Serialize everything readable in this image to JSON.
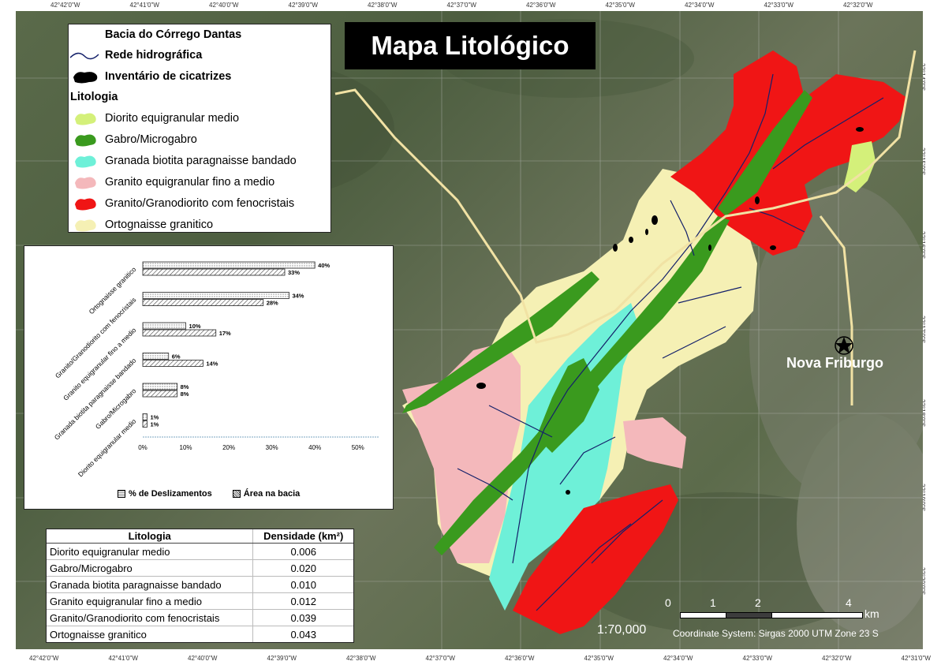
{
  "title": "Mapa Litológico",
  "coords_top": [
    "42°42'0\"W",
    "42°41'0\"W",
    "42°40'0\"W",
    "42°39'0\"W",
    "42°38'0\"W",
    "42°37'0\"W",
    "42°36'0\"W",
    "42°35'0\"W",
    "42°34'0\"W",
    "42°33'0\"W",
    "42°32'0\"W"
  ],
  "coords_bottom": [
    "42°42'0\"W",
    "42°41'0\"W",
    "42°40'0\"W",
    "42°39'0\"W",
    "42°38'0\"W",
    "42°37'0\"W",
    "42°36'0\"W",
    "42°35'0\"W",
    "42°34'0\"W",
    "42°33'0\"W",
    "42°32'0\"W",
    "42°31'0\"W"
  ],
  "coords_right": [
    "22°14'0\"S",
    "22°15'0\"S",
    "22°16'0\"S",
    "22°17'0\"S",
    "22°18'0\"S",
    "22°19'0\"S",
    "22°20'0\"S"
  ],
  "legend": {
    "basin": "Bacia do Córrego Dantas",
    "hydro": "Rede hidrográfica",
    "scars": "Inventário de cicatrizes",
    "lithology_header": "Litologia",
    "items": [
      {
        "label": "Diorito equigranular medio",
        "color": "#d4f07a"
      },
      {
        "label": "Gabro/Microgabro",
        "color": "#3a9a1e"
      },
      {
        "label": "Granada biotita paragnaisse bandado",
        "color": "#6ef0d8"
      },
      {
        "label": "Granito equigranular fino a medio",
        "color": "#f4b8bb"
      },
      {
        "label": "Granito/Granodiorito com fenocristais",
        "color": "#f01515"
      },
      {
        "label": "Ortognaisse granitico",
        "color": "#f5f0b4"
      }
    ]
  },
  "chart_data": {
    "type": "bar",
    "orientation": "horizontal",
    "categories": [
      "Ortognaisse granitico",
      "Granito/Granodiorito com fenocristais",
      "Granito equigranular fino a medio",
      "Granada biotita paragnaisse bandado",
      "Gabro/Microgabro",
      "Diorito equigranular medio"
    ],
    "series": [
      {
        "name": "% de Deslizamentos",
        "values": [
          40,
          34,
          10,
          6,
          8,
          1
        ],
        "labels": [
          "40%",
          "34%",
          "10%",
          "6%",
          "8%",
          "1%"
        ]
      },
      {
        "name": "Área na bacia",
        "values": [
          33,
          28,
          17,
          14,
          8,
          1
        ],
        "labels": [
          "33%",
          "28%",
          "17%",
          "14%",
          "8%",
          "1%"
        ]
      }
    ],
    "xticks": [
      "0%",
      "10%",
      "20%",
      "30%",
      "40%",
      "50%"
    ],
    "xlim": [
      0,
      55
    ]
  },
  "table": {
    "headers": [
      "Litologia",
      "Densidade (km²)"
    ],
    "rows": [
      [
        "Diorito equigranular medio",
        "0.006"
      ],
      [
        "Gabro/Microgabro",
        "0.020"
      ],
      [
        "Granada biotita paragnaisse bandado",
        "0.010"
      ],
      [
        "Granito equigranular fino a medio",
        "0.012"
      ],
      [
        "Granito/Granodiorito com fenocristais",
        "0.039"
      ],
      [
        "Ortognaisse granitico",
        "0.043"
      ]
    ]
  },
  "city": "Nova Friburgo",
  "scale": {
    "ticks": [
      "0",
      "1",
      "2",
      "4"
    ],
    "unit": "km",
    "ratio": "1:70,000"
  },
  "coordinate_system": "Coordinate System: Sirgas 2000 UTM Zone 23 S"
}
